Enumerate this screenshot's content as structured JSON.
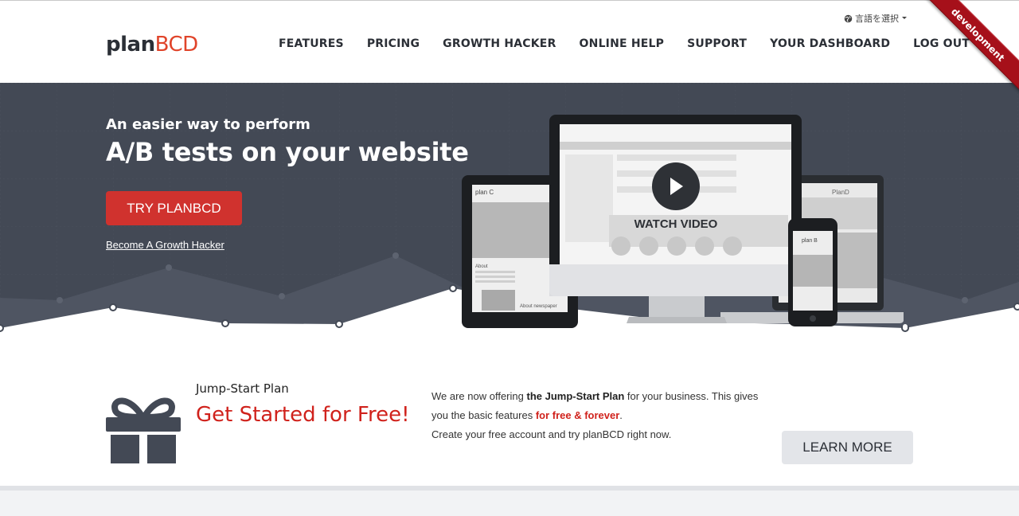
{
  "header": {
    "logo_part1": "plan",
    "logo_part2": "BCD",
    "language_label": "言語を選択",
    "ribbon_label": "development",
    "nav": [
      {
        "label": "FEATURES"
      },
      {
        "label": "PRICING"
      },
      {
        "label": "GROWTH HACKER"
      },
      {
        "label": "ONLINE HELP"
      },
      {
        "label": "SUPPORT"
      },
      {
        "label": "YOUR DASHBOARD"
      },
      {
        "label": "LOG OUT"
      }
    ]
  },
  "hero": {
    "subtitle": "An easier way to perform",
    "title": "A/B tests on your website",
    "cta_label": "TRY PLANBCD",
    "secondary_link": "Become A Growth Hacker",
    "video_label": "WATCH VIDEO",
    "tablet_label": "plan C",
    "laptop_label": "PlanD",
    "phone_label": "plan B",
    "tablet_about": "About",
    "tablet_news": "About newspaper",
    "colors": {
      "hero_bg": "#434955",
      "cta": "#d0322e"
    }
  },
  "promo": {
    "label": "Jump-Start Plan",
    "title": "Get Started for Free!",
    "text_intro": "We are now offering ",
    "text_bold": "the Jump-Start Plan",
    "text_mid": " for your business. This gives you the basic features ",
    "text_red": "for free & forever",
    "text_end": ".",
    "text_line2": "Create your free account and try planBCD right now.",
    "learn_label": "LEARN MORE",
    "icon": "gift-icon"
  }
}
